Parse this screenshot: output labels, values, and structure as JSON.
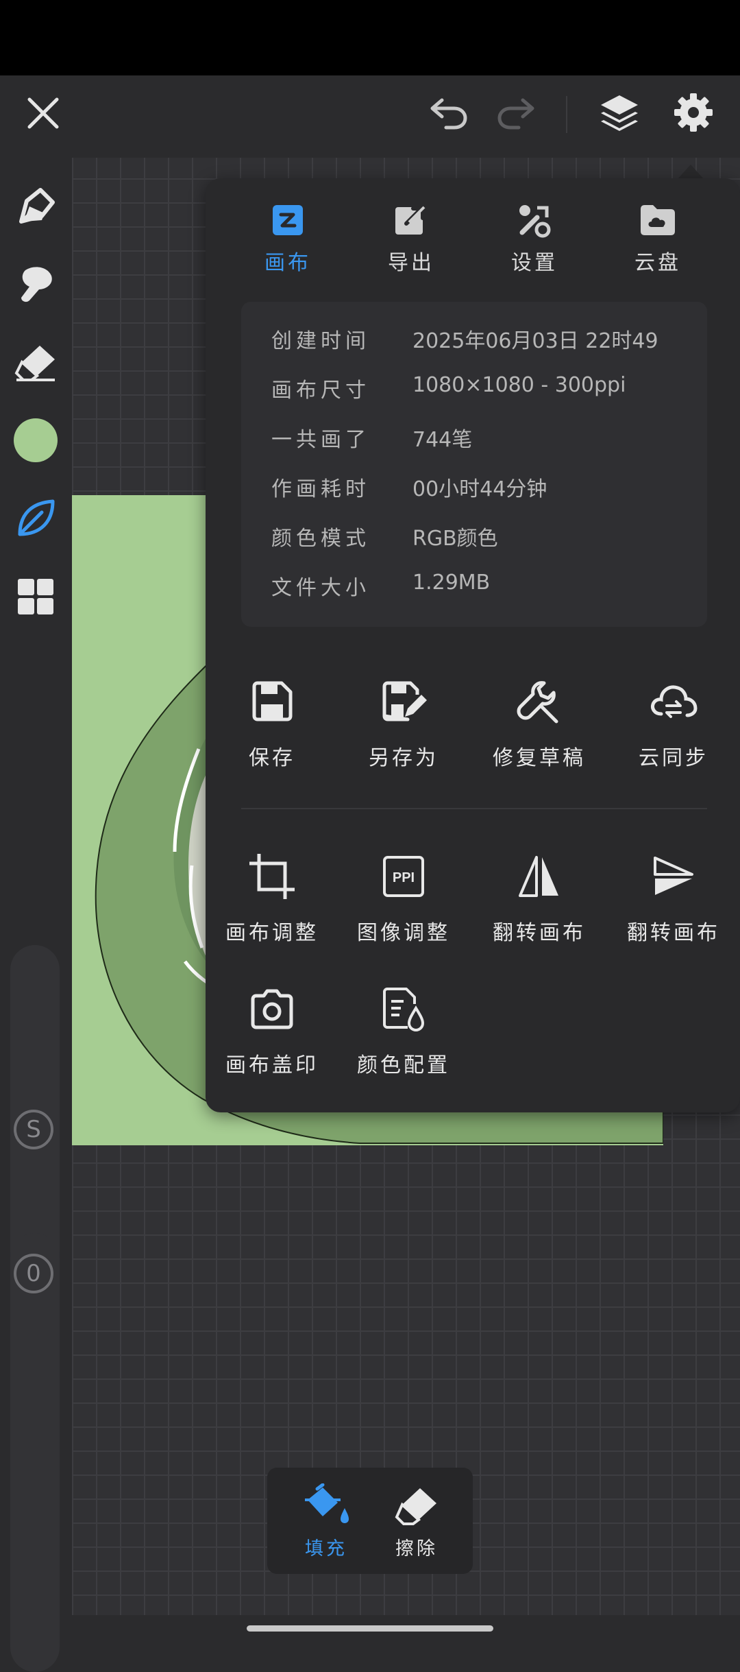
{
  "colors": {
    "accent": "#3a97f0",
    "current_brush_color": "#a6cd92",
    "panel_bg": "#29292b"
  },
  "top_bar": {
    "close_icon": "close-icon",
    "undo_icon": "undo-icon",
    "redo_icon": "redo-icon",
    "layers_icon": "layers-icon",
    "settings_icon": "gear-icon"
  },
  "left_toolbar": {
    "tools": [
      "pen-icon",
      "smudge-icon",
      "eraser-icon",
      "color-swatch",
      "leaf-brush-icon",
      "grid-icon"
    ],
    "size_slider_label": "S",
    "opacity_slider_label": "0"
  },
  "menu": {
    "tabs": [
      {
        "label": "画布",
        "icon": "canvas-icon",
        "active": true
      },
      {
        "label": "导出",
        "icon": "export-icon",
        "active": false
      },
      {
        "label": "设置",
        "icon": "tools-icon",
        "active": false
      },
      {
        "label": "云盘",
        "icon": "cloud-drive-icon",
        "active": false
      }
    ],
    "info": [
      {
        "label": "创建时间",
        "value": "2025年06月03日 22时49"
      },
      {
        "label": "画布尺寸",
        "value": "1080×1080 - 300ppi"
      },
      {
        "label": "一共画了",
        "value": "744笔"
      },
      {
        "label": "作画耗时",
        "value": "00小时44分钟"
      },
      {
        "label": "颜色模式",
        "value": "RGB颜色"
      },
      {
        "label": "文件大小",
        "value": "1.29MB"
      }
    ],
    "actions_row1": [
      {
        "label": "保存",
        "icon": "save-icon"
      },
      {
        "label": "另存为",
        "icon": "save-as-icon"
      },
      {
        "label": "修复草稿",
        "icon": "wrench-icon"
      },
      {
        "label": "云同步",
        "icon": "cloud-sync-icon"
      }
    ],
    "actions_row2": [
      {
        "label": "画布调整",
        "icon": "crop-icon"
      },
      {
        "label": "图像调整",
        "icon": "ppi-icon"
      },
      {
        "label": "翻转画布",
        "icon": "flip-horizontal-icon"
      },
      {
        "label": "翻转画布",
        "icon": "flip-vertical-icon"
      }
    ],
    "actions_row3": [
      {
        "label": "画布盖印",
        "icon": "camera-icon"
      },
      {
        "label": "颜色配置",
        "icon": "color-config-icon"
      }
    ]
  },
  "bottom_tools": [
    {
      "label": "填充",
      "icon": "fill-bucket-icon",
      "active": true
    },
    {
      "label": "擦除",
      "icon": "eraser-icon",
      "active": false
    }
  ]
}
